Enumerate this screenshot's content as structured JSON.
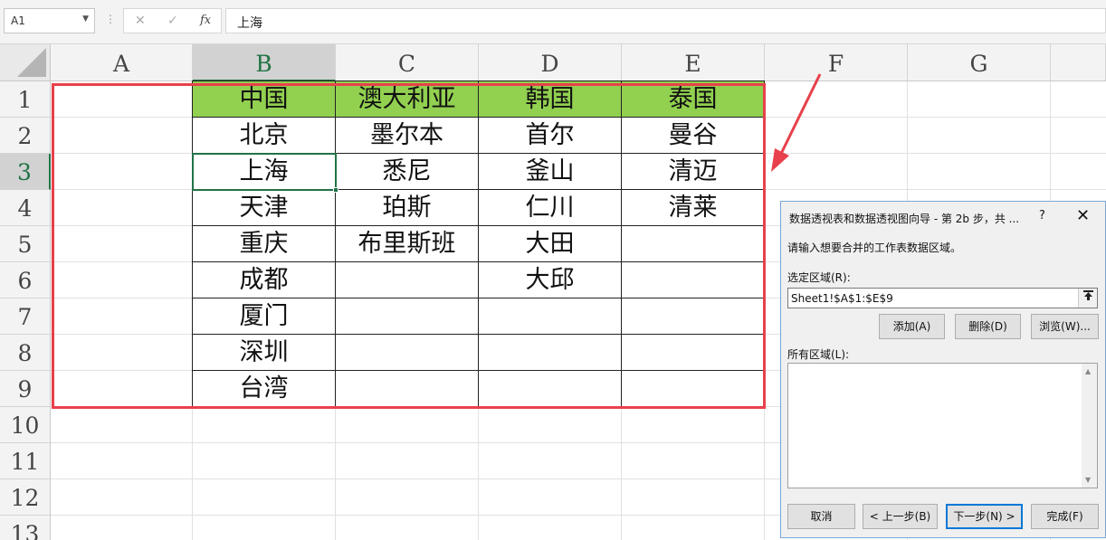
{
  "formula_bar": {
    "name_box": "A1",
    "cancel_glyph": "✕",
    "enter_glyph": "✓",
    "fx_glyph": "fx",
    "formula_value": "上海",
    "separator": "⋮"
  },
  "columns": [
    "A",
    "B",
    "C",
    "D",
    "E",
    "F",
    "G"
  ],
  "rows": [
    "1",
    "2",
    "3",
    "4",
    "5",
    "6",
    "7",
    "8",
    "9",
    "10",
    "11",
    "12",
    "13"
  ],
  "table": {
    "header": [
      "中国",
      "澳大利亚",
      "韩国",
      "泰国"
    ],
    "body": [
      [
        "北京",
        "墨尔本",
        "首尔",
        "曼谷"
      ],
      [
        "上海",
        "悉尼",
        "釜山",
        "清迈"
      ],
      [
        "天津",
        "珀斯",
        "仁川",
        "清莱"
      ],
      [
        "重庆",
        "布里斯班",
        "大田",
        ""
      ],
      [
        "成都",
        "",
        "大邱",
        ""
      ],
      [
        "厦门",
        "",
        "",
        ""
      ],
      [
        "深圳",
        "",
        "",
        ""
      ],
      [
        "台湾",
        "",
        "",
        ""
      ]
    ]
  },
  "colors": {
    "header_fill": "#92d050",
    "range_highlight": "#e8414b",
    "selection": "#217346",
    "dialog_accent": "#0078d7"
  },
  "dialog": {
    "title": "数据透视表和数据透视图向导 - 第 2b 步，共 ...",
    "help_glyph": "?",
    "close_glyph": "✕",
    "prompt": "请输入想要合并的工作表数据区域。",
    "range_label": "选定区域(R):",
    "range_value": "Sheet1!$A$1:$E$9",
    "collapse_icon": "collapse-dialog-icon",
    "add_button": "添加(A)",
    "delete_button": "删除(D)",
    "browse_button": "浏览(W)...",
    "all_ranges_label": "所有区域(L):",
    "cancel_button": "取消",
    "back_button": "< 上一步(B)",
    "next_button": "下一步(N) >",
    "finish_button": "完成(F)"
  }
}
